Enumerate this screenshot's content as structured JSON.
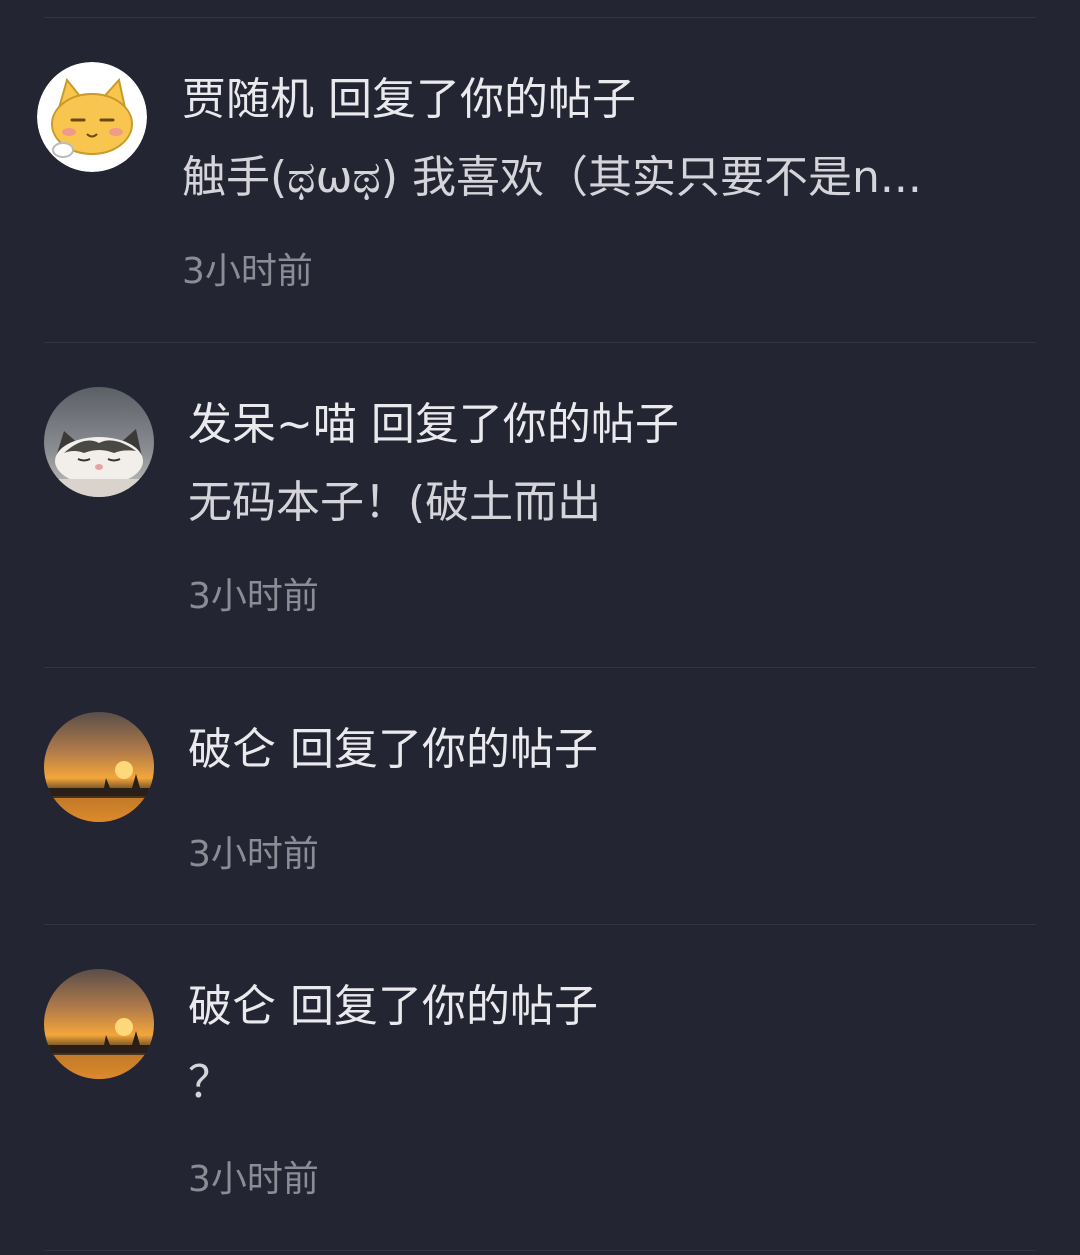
{
  "notifications": [
    {
      "user": "贾随机",
      "action": "回复了你的帖子",
      "content": "触手(ಥωಥ) 我喜欢（其实只要不是n...",
      "time": "3小时前",
      "avatar": "yellow-cat-avatar"
    },
    {
      "user": "发呆~喵",
      "action": "回复了你的帖子",
      "content": "无码本子！(破土而出",
      "time": "3小时前",
      "avatar": "sleeping-cat-photo-avatar"
    },
    {
      "user": "破仑",
      "action": "回复了你的帖子",
      "content": "",
      "time": "3小时前",
      "avatar": "sunset-photo-avatar"
    },
    {
      "user": "破仑",
      "action": "回复了你的帖子",
      "content": "？",
      "time": "3小时前",
      "avatar": "sunset-photo-avatar"
    }
  ],
  "colors": {
    "background": "#242532",
    "divider": "#333542",
    "title_text": "#e9e9ee",
    "time_text": "#8b8c95"
  }
}
